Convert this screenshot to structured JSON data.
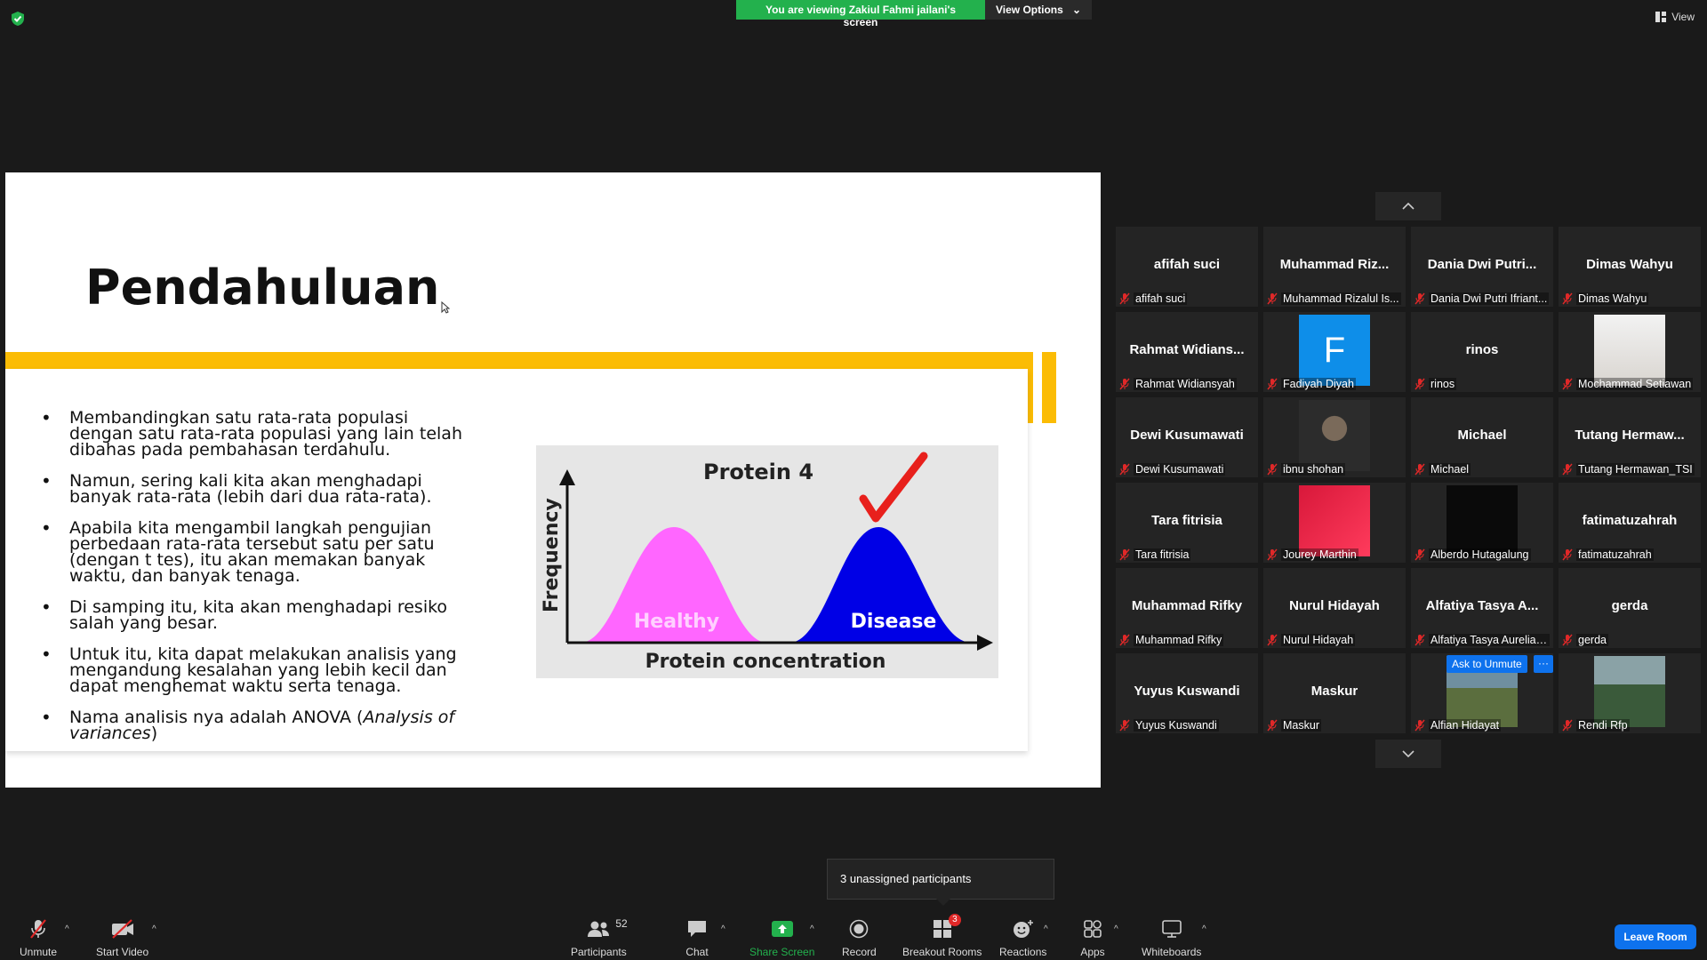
{
  "top_bar": {
    "viewing_text": "You are viewing Zakiul Fahmi jailani's screen",
    "view_options_label": "View Options",
    "view_label": "View"
  },
  "slide": {
    "title": "Pendahuluan",
    "bullets": [
      "Membandingkan satu rata-rata populasi dengan satu rata-rata populasi yang lain telah dibahas pada pembahasan terdahulu.",
      "Namun, sering kali kita akan menghadapi banyak rata-rata (lebih dari dua rata-rata).",
      "Apabila kita mengambil langkah pengujian perbedaan rata-rata tersebut satu per satu (dengan t tes), itu akan memakan banyak waktu, dan banyak tenaga.",
      "Di samping itu, kita akan menghadapi resiko salah yang besar.",
      "Untuk itu, kita dapat melakukan analisis yang mengandung kesalahan yang lebih kecil dan dapat menghemat waktu serta tenaga."
    ],
    "last_bullet_prefix": "Nama analisis nya adalah ANOVA (",
    "last_bullet_italic": "Analysis of variances",
    "last_bullet_suffix": ")",
    "figure": {
      "title": "Protein 4",
      "y_label": "Frequency",
      "x_label": "Protein concentration",
      "curve_left_label": "Healthy",
      "curve_right_label": "Disease",
      "colors": {
        "healthy": "#ff66ff",
        "disease": "#0000e6",
        "check": "#e8201c"
      }
    }
  },
  "participants": {
    "tiles": [
      {
        "big": "afifah suci",
        "label": "afifah suci",
        "type": "name"
      },
      {
        "big": "Muhammad  Riz...",
        "label": "Muhammad Rizalul Is...",
        "type": "name"
      },
      {
        "big": "Dania  Dwi  Putri...",
        "label": "Dania Dwi Putri Ifriant...",
        "type": "name"
      },
      {
        "big": "Dimas Wahyu",
        "label": "Dimas Wahyu",
        "type": "name"
      },
      {
        "big": "Rahmat  Widians...",
        "label": "Rahmat Widiansyah",
        "type": "name"
      },
      {
        "big": "F",
        "label": "Fadiyah Diyah",
        "type": "letter"
      },
      {
        "big": "rinos",
        "label": "rinos",
        "type": "name"
      },
      {
        "big": "",
        "label": "Mochammad Setiawan",
        "type": "photo-light"
      },
      {
        "big": "Dewi Kusumawati",
        "label": "Dewi Kusumawati",
        "type": "name"
      },
      {
        "big": "",
        "label": "ibnu shohan",
        "type": "photo-dark"
      },
      {
        "big": "Michael",
        "label": "Michael",
        "type": "name"
      },
      {
        "big": "Tutang  Hermaw...",
        "label": "Tutang Hermawan_TSI",
        "type": "name"
      },
      {
        "big": "Tara fitrisia",
        "label": "Tara fitrisia",
        "type": "name"
      },
      {
        "big": "",
        "label": "Jourey Marthin",
        "type": "photo-red"
      },
      {
        "big": "",
        "label": "Alberdo Hutagalung",
        "type": "photo-black"
      },
      {
        "big": "fatimatuzahrah",
        "label": "fatimatuzahrah",
        "type": "name"
      },
      {
        "big": "Muhammad Rifky",
        "label": "Muhammad Rifky",
        "type": "name"
      },
      {
        "big": "Nurul Hidayah",
        "label": "Nurul Hidayah",
        "type": "name"
      },
      {
        "big": "Alfatiya  Tasya  A...",
        "label": "Alfatiya Tasya Aurelia ...",
        "type": "name"
      },
      {
        "big": "gerda",
        "label": "gerda",
        "type": "name"
      },
      {
        "big": "Yuyus Kuswandi",
        "label": "Yuyus Kuswandi",
        "type": "name"
      },
      {
        "big": "Maskur",
        "label": "Maskur",
        "type": "name"
      },
      {
        "big": "",
        "label": "Alfian Hidayat",
        "type": "photo-green",
        "ask_unmute": "Ask to Unmute",
        "more": "···"
      },
      {
        "big": "",
        "label": "Rendi Rfp",
        "type": "photo-person"
      }
    ]
  },
  "tooltip": {
    "text": "3 unassigned participants"
  },
  "toolbar": {
    "unmute": "Unmute",
    "start_video": "Start Video",
    "participants": "Participants",
    "participants_count": "52",
    "chat": "Chat",
    "share_screen": "Share Screen",
    "record": "Record",
    "breakout_rooms": "Breakout Rooms",
    "breakout_badge": "3",
    "reactions": "Reactions",
    "apps": "Apps",
    "whiteboards": "Whiteboards",
    "leave_room": "Leave Room"
  },
  "colors": {
    "accent_blue": "#0e72ed",
    "share_green": "#23b14d",
    "slide_yellow": "#fbbc05",
    "muted_red": "#e02828"
  }
}
